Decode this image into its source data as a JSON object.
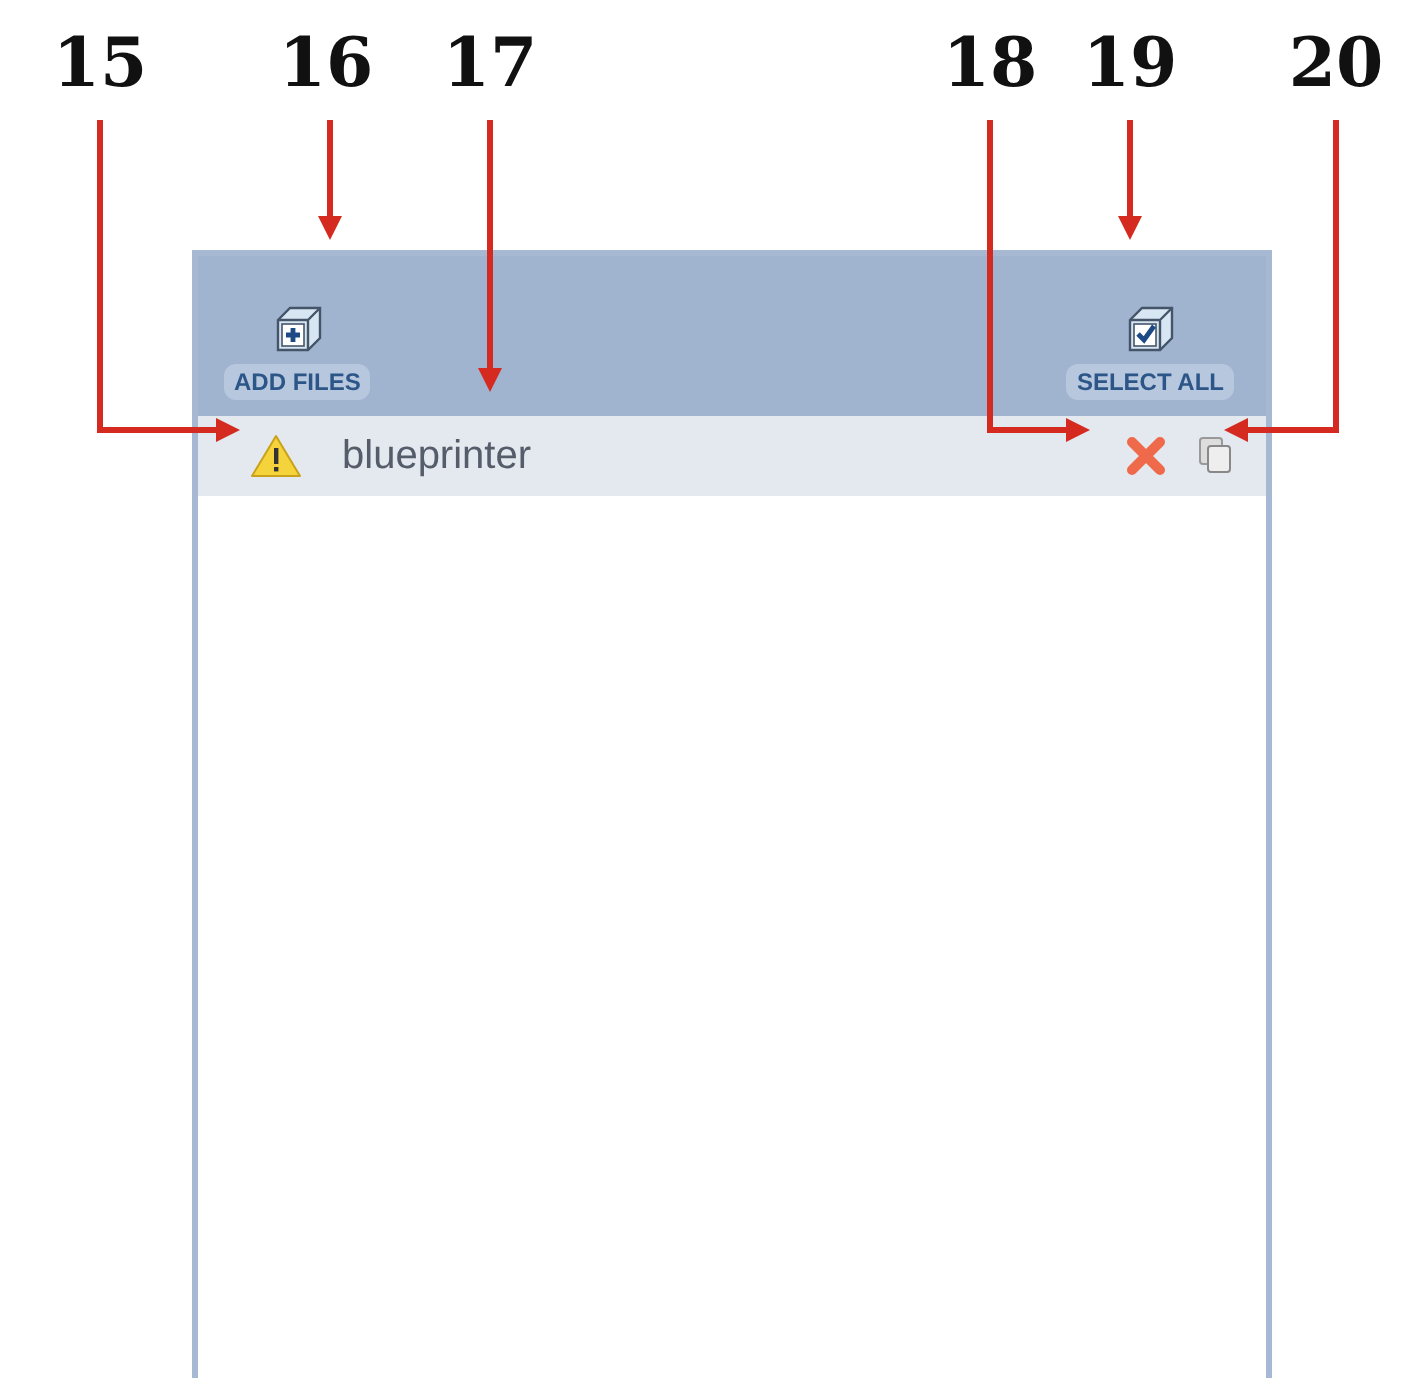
{
  "callouts": [
    {
      "number": "15"
    },
    {
      "number": "16"
    },
    {
      "number": "17"
    },
    {
      "number": "18"
    },
    {
      "number": "19"
    },
    {
      "number": "20"
    }
  ],
  "toolbar": {
    "add_files": "ADD FILES",
    "select_all": "SELECT ALL"
  },
  "files": [
    {
      "name": "blueprinter",
      "warning": true
    }
  ]
}
